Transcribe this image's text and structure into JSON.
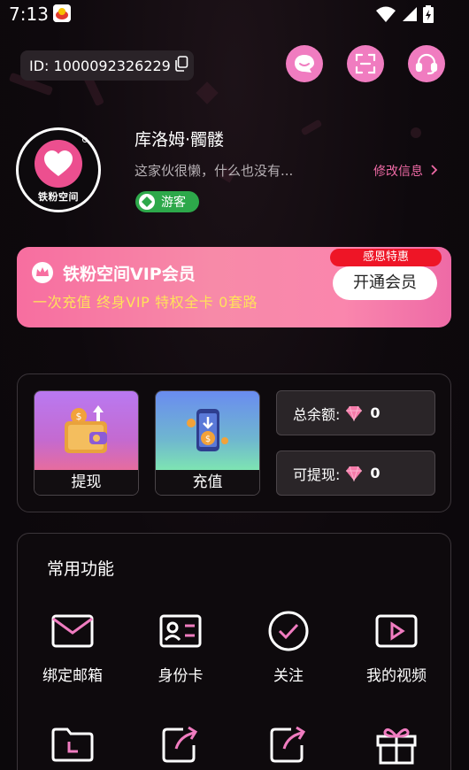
{
  "status_bar": {
    "time": "7:13"
  },
  "header": {
    "id_text": "ID: 1000092326229"
  },
  "profile": {
    "username": "库洛姆·髑髅",
    "bio": "这家伙很懒，什么也没有...",
    "edit_label": "修改信息",
    "badge_label": "游客",
    "avatar_text": "铁粉空间"
  },
  "vip": {
    "title": "铁粉空间VIP会员",
    "subtitle": "一次充值 终身VIP 特权全卡 0套路",
    "tag": "感恩特惠",
    "button": "开通会员"
  },
  "wallet": {
    "withdraw_label": "提现",
    "recharge_label": "充值",
    "total_label": "总余额:",
    "total_value": "0",
    "withdrawable_label": "可提现:",
    "withdrawable_value": "0"
  },
  "functions": {
    "title": "常用功能",
    "items": [
      {
        "label": "绑定邮箱",
        "icon": "mail-icon"
      },
      {
        "label": "身份卡",
        "icon": "id-card-icon"
      },
      {
        "label": "关注",
        "icon": "check-circle-icon"
      },
      {
        "label": "我的视频",
        "icon": "video-icon"
      },
      {
        "label": "",
        "icon": "history-folder-icon"
      },
      {
        "label": "",
        "icon": "share-icon"
      },
      {
        "label": "",
        "icon": "share-icon"
      },
      {
        "label": "",
        "icon": "gift-icon"
      }
    ]
  },
  "colors": {
    "accent_pink": "#f07cc0",
    "vip_yellow": "#ffe25a",
    "guest_green": "#2da84a",
    "tag_red": "#ee1526"
  }
}
